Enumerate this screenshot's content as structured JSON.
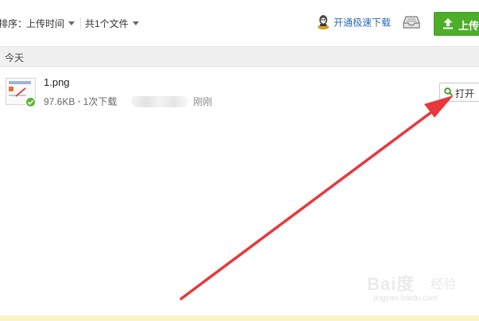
{
  "toolbar": {
    "sort_label": "排序：",
    "sort_value": "上传时间",
    "file_count": "共1个文件",
    "speed_download": "开通极速下载",
    "upload_label": "上传"
  },
  "group": {
    "title": "今天"
  },
  "file": {
    "name": "1.png",
    "size": "97.6KB",
    "downloads": "1次下载",
    "time": "刚刚",
    "open_label": "打开"
  },
  "watermark": {
    "brand": "Bai度",
    "jingyan": "经验",
    "url": "jingyan.baidu.com"
  },
  "colors": {
    "upload_green": "#4dae2a",
    "link_blue": "#2b6bb5",
    "annotation_red": "#e8383d"
  }
}
